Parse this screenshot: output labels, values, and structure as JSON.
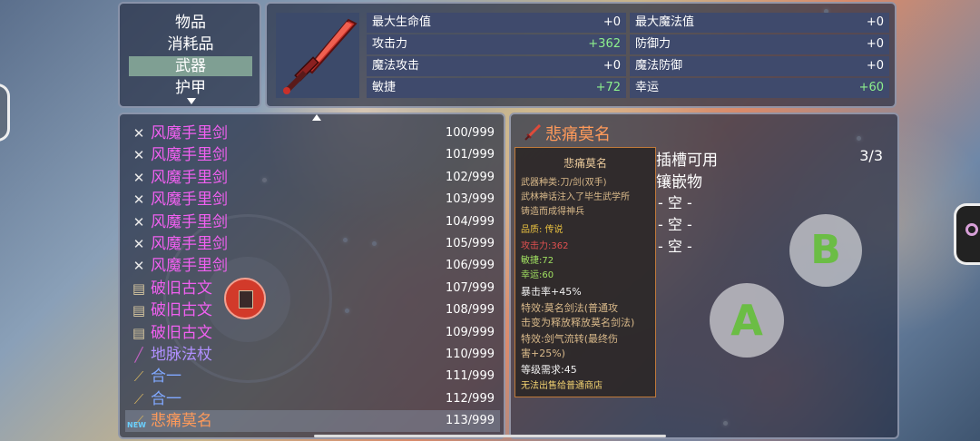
{
  "categories": {
    "items": [
      "物品",
      "消耗品",
      "武器",
      "护甲"
    ],
    "selected_index": 2
  },
  "stats": {
    "left": [
      {
        "label": "最大生命值",
        "value": "+0"
      },
      {
        "label": "攻击力",
        "value": "+362"
      },
      {
        "label": "魔法攻击",
        "value": "+0"
      },
      {
        "label": "敏捷",
        "value": "+72"
      }
    ],
    "right": [
      {
        "label": "最大魔法值",
        "value": "+0"
      },
      {
        "label": "防御力",
        "value": "+0"
      },
      {
        "label": "魔法防御",
        "value": "+0"
      },
      {
        "label": "幸运",
        "value": "+60"
      }
    ]
  },
  "items": [
    {
      "name": "风魔手里剑",
      "count": "100/999",
      "icon": "shuriken-icon",
      "color": "#f060f0"
    },
    {
      "name": "风魔手里剑",
      "count": "101/999",
      "icon": "shuriken-icon",
      "color": "#f060f0"
    },
    {
      "name": "风魔手里剑",
      "count": "102/999",
      "icon": "shuriken-icon",
      "color": "#f060f0"
    },
    {
      "name": "风魔手里剑",
      "count": "103/999",
      "icon": "shuriken-icon",
      "color": "#f060f0"
    },
    {
      "name": "风魔手里剑",
      "count": "104/999",
      "icon": "shuriken-icon",
      "color": "#f060f0"
    },
    {
      "name": "风魔手里剑",
      "count": "105/999",
      "icon": "shuriken-icon",
      "color": "#f060f0"
    },
    {
      "name": "风魔手里剑",
      "count": "106/999",
      "icon": "shuriken-icon",
      "color": "#f060f0"
    },
    {
      "name": "破旧古文",
      "count": "107/999",
      "icon": "scroll-icon",
      "color": "#f060f0"
    },
    {
      "name": "破旧古文",
      "count": "108/999",
      "icon": "scroll-icon",
      "color": "#f060f0"
    },
    {
      "name": "破旧古文",
      "count": "109/999",
      "icon": "scroll-icon",
      "color": "#f060f0"
    },
    {
      "name": "地脉法杖",
      "count": "110/999",
      "icon": "staff-icon",
      "color": "#b090ff"
    },
    {
      "name": "合一",
      "count": "111/999",
      "icon": "sword-icon",
      "color": "#80a8ff"
    },
    {
      "name": "合一",
      "count": "112/999",
      "icon": "sword-icon",
      "color": "#80a8ff"
    },
    {
      "name": "悲痛莫名",
      "count": "113/999",
      "icon": "sword-icon",
      "color": "#ff9a5a",
      "new": "NEW"
    }
  ],
  "detail": {
    "title": "悲痛莫名",
    "tooltip": {
      "title": "悲痛莫名",
      "type": "武器种类:刀/剑(双手)",
      "desc1": "武林神话注入了毕生武学所",
      "desc2": "铸造而成得神兵",
      "quality": "品质: 传说",
      "attack": "攻击力:362",
      "agility": "敏捷:72",
      "luck": "幸运:60",
      "crit": "暴击率+45%",
      "effect1a": "特效:莫名剑法(普通攻",
      "effect1b": "击变为释放释放莫名剑法)",
      "effect2a": "特效:剑气流转(最终伤",
      "effect2b": "害+25%)",
      "level": "等级需求:45",
      "shop": "无法出售给普通商店"
    },
    "socket_title_1": "插槽可用",
    "socket_title_2": "镶嵌物",
    "socket_count": "3/3",
    "slots": [
      "- 空 -",
      "- 空 -",
      "- 空 -"
    ]
  },
  "controls": {
    "button_a": "A",
    "button_b": "B"
  }
}
